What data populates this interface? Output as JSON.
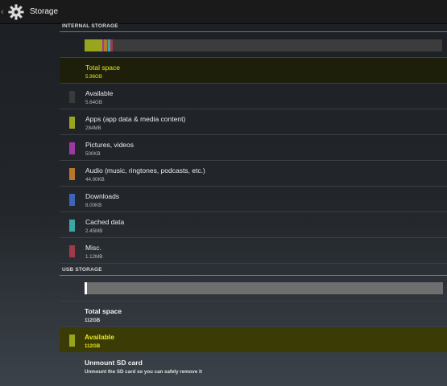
{
  "action_bar": {
    "title": "Storage",
    "up_icon": "chevron-left-icon",
    "app_icon": "gear-icon"
  },
  "internal": {
    "header": "INTERNAL STORAGE",
    "usage_fractions": [
      {
        "name": "Apps (app data & media content)",
        "color": "#9aa51e",
        "fraction": 0.05
      },
      {
        "name": "Pictures, videos",
        "color": "#9b3aa0",
        "fraction": 0.004
      },
      {
        "name": "Audio (music, ringtones, podcasts, etc.)",
        "color": "#b8772a",
        "fraction": 0.008
      },
      {
        "name": "Downloads",
        "color": "#3e64b7",
        "fraction": 0.004
      },
      {
        "name": "Cached data",
        "color": "#3aa6a6",
        "fraction": 0.006
      },
      {
        "name": "Misc.",
        "color": "#a03a48",
        "fraction": 0.006
      }
    ],
    "total": {
      "title": "Total space",
      "value": "5.96GB"
    },
    "items": [
      {
        "title": "Available",
        "value": "5.64GB",
        "color": "#3a3a3a"
      },
      {
        "title": "Apps (app data & media content)",
        "value": "284MB",
        "color": "#9aa51e"
      },
      {
        "title": "Pictures, videos",
        "value": "500KB",
        "color": "#9b3aa0"
      },
      {
        "title": "Audio (music, ringtones, podcasts, etc.)",
        "value": "44.00KB",
        "color": "#b8772a"
      },
      {
        "title": "Downloads",
        "value": "8.00KB",
        "color": "#3e64b7"
      },
      {
        "title": "Cached data",
        "value": "2.45MB",
        "color": "#3aa6a6"
      },
      {
        "title": "Misc.",
        "value": "1.12MB",
        "color": "#a03a48"
      }
    ]
  },
  "usb": {
    "header": "USB STORAGE",
    "used_fraction": 0.006,
    "total": {
      "title": "Total space",
      "value": "112GB"
    },
    "available": {
      "title": "Available",
      "value": "112GB",
      "color": "#9aa51e"
    },
    "unmount": {
      "title": "Unmount SD card",
      "description": "Unmount the SD card so you can safely remove it"
    }
  }
}
